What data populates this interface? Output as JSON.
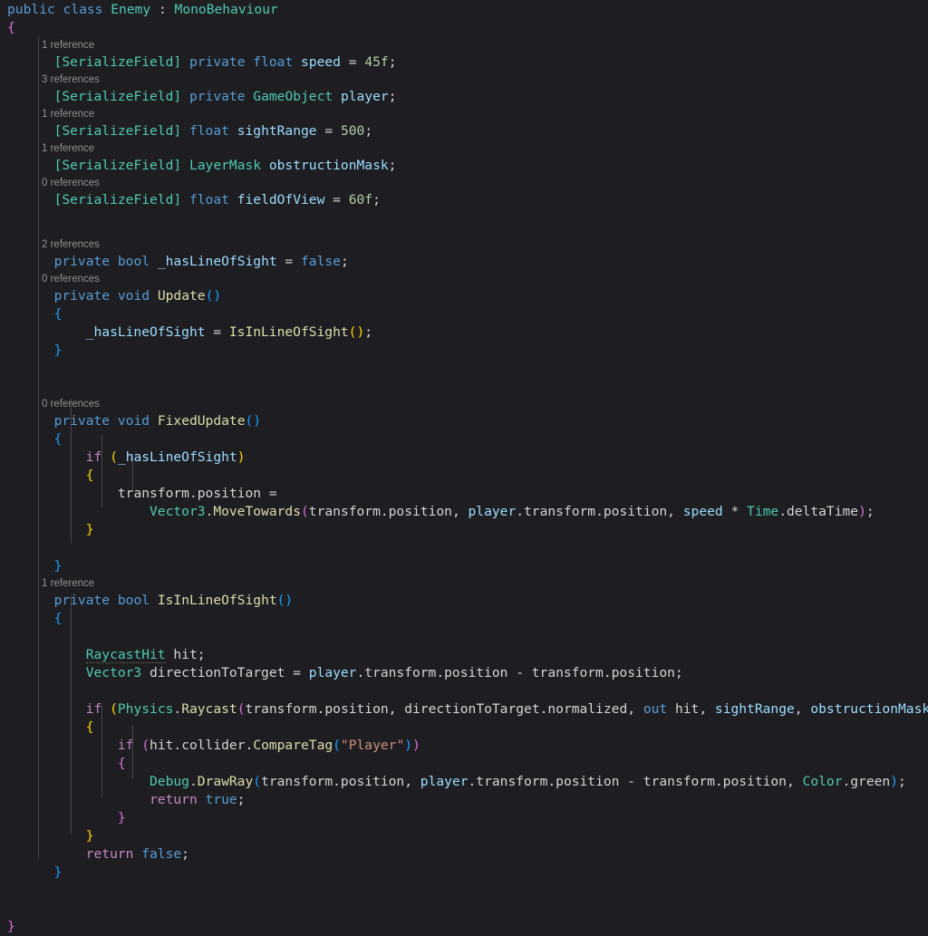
{
  "editor": {
    "language": "csharp",
    "theme": "dark-modern",
    "background": "#1e1e22",
    "font_size_px": 14.6,
    "line_height_px": 20,
    "colors": {
      "keyword": "#569cd6",
      "control_keyword": "#c586c0",
      "type": "#4ec9b0",
      "method": "#dcdcaa",
      "field": "#9cdcfe",
      "number": "#b5cea8",
      "string": "#ce9178",
      "plain": "#d4d4d4",
      "codelens": "#919191",
      "indent_guide": "#47474b",
      "bracket_level_0": "#da70d6",
      "bracket_level_1": "#179fff",
      "bracket_level_2": "#ffd700"
    }
  },
  "codelens": {
    "speed": "1 reference",
    "player": "3 references",
    "sightRange": "1 reference",
    "obstructionMask": "1 reference",
    "fieldOfView": "0 references",
    "hasLineOfSight": "2 references",
    "update": "0 references",
    "fixedUpdate": "0 references",
    "isInLineOfSight": "1 reference"
  },
  "code": {
    "class_decl": {
      "modifier": "public",
      "keyword": "class",
      "name": "Enemy",
      "colon": " : ",
      "base": "MonoBehaviour"
    },
    "brace_open_class": "{",
    "brace_close_class": "}",
    "fields": {
      "speed": {
        "attribute_open": "[",
        "attribute": "SerializeField",
        "attribute_close": "]",
        "modifier": "private",
        "type": "float",
        "name": "speed",
        "assign": " = ",
        "value": "45f",
        "semi": ";"
      },
      "player": {
        "attribute_open": "[",
        "attribute": "SerializeField",
        "attribute_close": "]",
        "modifier": "private",
        "type": "GameObject",
        "name": "player",
        "semi": ";"
      },
      "sightRange": {
        "attribute_open": "[",
        "attribute": "SerializeField",
        "attribute_close": "]",
        "type": "float",
        "name": "sightRange",
        "assign": " = ",
        "value": "500",
        "semi": ";"
      },
      "obstructionMask": {
        "attribute_open": "[",
        "attribute": "SerializeField",
        "attribute_close": "]",
        "type": "LayerMask",
        "name": "obstructionMask",
        "semi": ";"
      },
      "fieldOfView": {
        "attribute_open": "[",
        "attribute": "SerializeField",
        "attribute_close": "]",
        "type": "float",
        "name": "fieldOfView",
        "assign": " = ",
        "value": "60f",
        "semi": ";"
      },
      "hasLineOfSight": {
        "modifier": "private",
        "type": "bool",
        "name": "_hasLineOfSight",
        "assign": " = ",
        "value": "false",
        "semi": ";"
      }
    },
    "update_method": {
      "modifier": "private",
      "return_type": "void",
      "name": "Update",
      "parens": "()",
      "brace_open": "{",
      "brace_close": "}",
      "body_target": "_hasLineOfSight",
      "body_assign": " = ",
      "body_call": "IsInLineOfSight",
      "body_parens": "()",
      "body_semi": ";"
    },
    "fixedupdate_method": {
      "modifier": "private",
      "return_type": "void",
      "name": "FixedUpdate",
      "parens": "()",
      "brace_open": "{",
      "brace_close": "}",
      "if_keyword": "if",
      "if_paren_open": "(",
      "if_cond": "_hasLineOfSight",
      "if_paren_close": ")",
      "if_brace_open": "{",
      "if_brace_close": "}",
      "stmt_target": "transform",
      "stmt_dot": ".",
      "stmt_member": "position",
      "stmt_assign": " =",
      "call_type": "Vector3",
      "call_method": "MoveTowards",
      "call_paren_open": "(",
      "arg1": "transform.position",
      "arg2_obj": "player",
      "arg2_rest": ".transform.position",
      "arg3_field": "speed",
      "arg3_op": " * ",
      "arg3_type": "Time",
      "arg3_member": ".deltaTime",
      "call_paren_close": ")",
      "call_semi": ";"
    },
    "isinlineofsight_method": {
      "modifier": "private",
      "return_type": "bool",
      "name": "IsInLineOfSight",
      "parens": "()",
      "brace_open": "{",
      "brace_close": "}",
      "decl1_type": "RaycastHit",
      "decl1_name": " hit",
      "decl1_semi": ";",
      "decl2_type": "Vector3",
      "decl2_name": " directionToTarget",
      "decl2_assign": " = ",
      "decl2_obj": "player",
      "decl2_rest": ".transform.position - transform.position",
      "decl2_semi": ";",
      "if_keyword": "if",
      "if_paren_open": "(",
      "if_type": "Physics",
      "if_dot": ".",
      "if_method": "Raycast",
      "if_inner_open": "(",
      "if_arg1": "transform.position, directionToTarget.normalized, ",
      "if_arg_out": "out",
      "if_arg_hit": " hit, ",
      "if_arg_sight": "sightRange",
      "if_arg_comma": ", ",
      "if_arg_mask": "obstructionMask",
      "if_inner_close": ")",
      "if_paren_close": ")",
      "if_brace_open": "{",
      "if_brace_close": "}",
      "if2_keyword": "if",
      "if2_paren_open": "(",
      "if2_obj": "hit.collider.",
      "if2_method": "CompareTag",
      "if2_inner_open": "(",
      "if2_string": "\"Player\"",
      "if2_inner_close": ")",
      "if2_paren_close": ")",
      "if2_brace_open": "{",
      "if2_brace_close": "}",
      "debug_type": "Debug",
      "debug_dot": ".",
      "debug_method": "DrawRay",
      "debug_paren_open": "(",
      "debug_arg1": "transform.position, ",
      "debug_arg2_obj": "player",
      "debug_arg2_rest": ".transform.position - transform.position, ",
      "debug_arg3_type": "Color",
      "debug_arg3_member": ".green",
      "debug_paren_close": ")",
      "debug_semi": ";",
      "return_true_kw": "return",
      "return_true_val": " true",
      "return_true_semi": ";",
      "return_false_kw": "return",
      "return_false_val": " false",
      "return_false_semi": ";"
    }
  }
}
